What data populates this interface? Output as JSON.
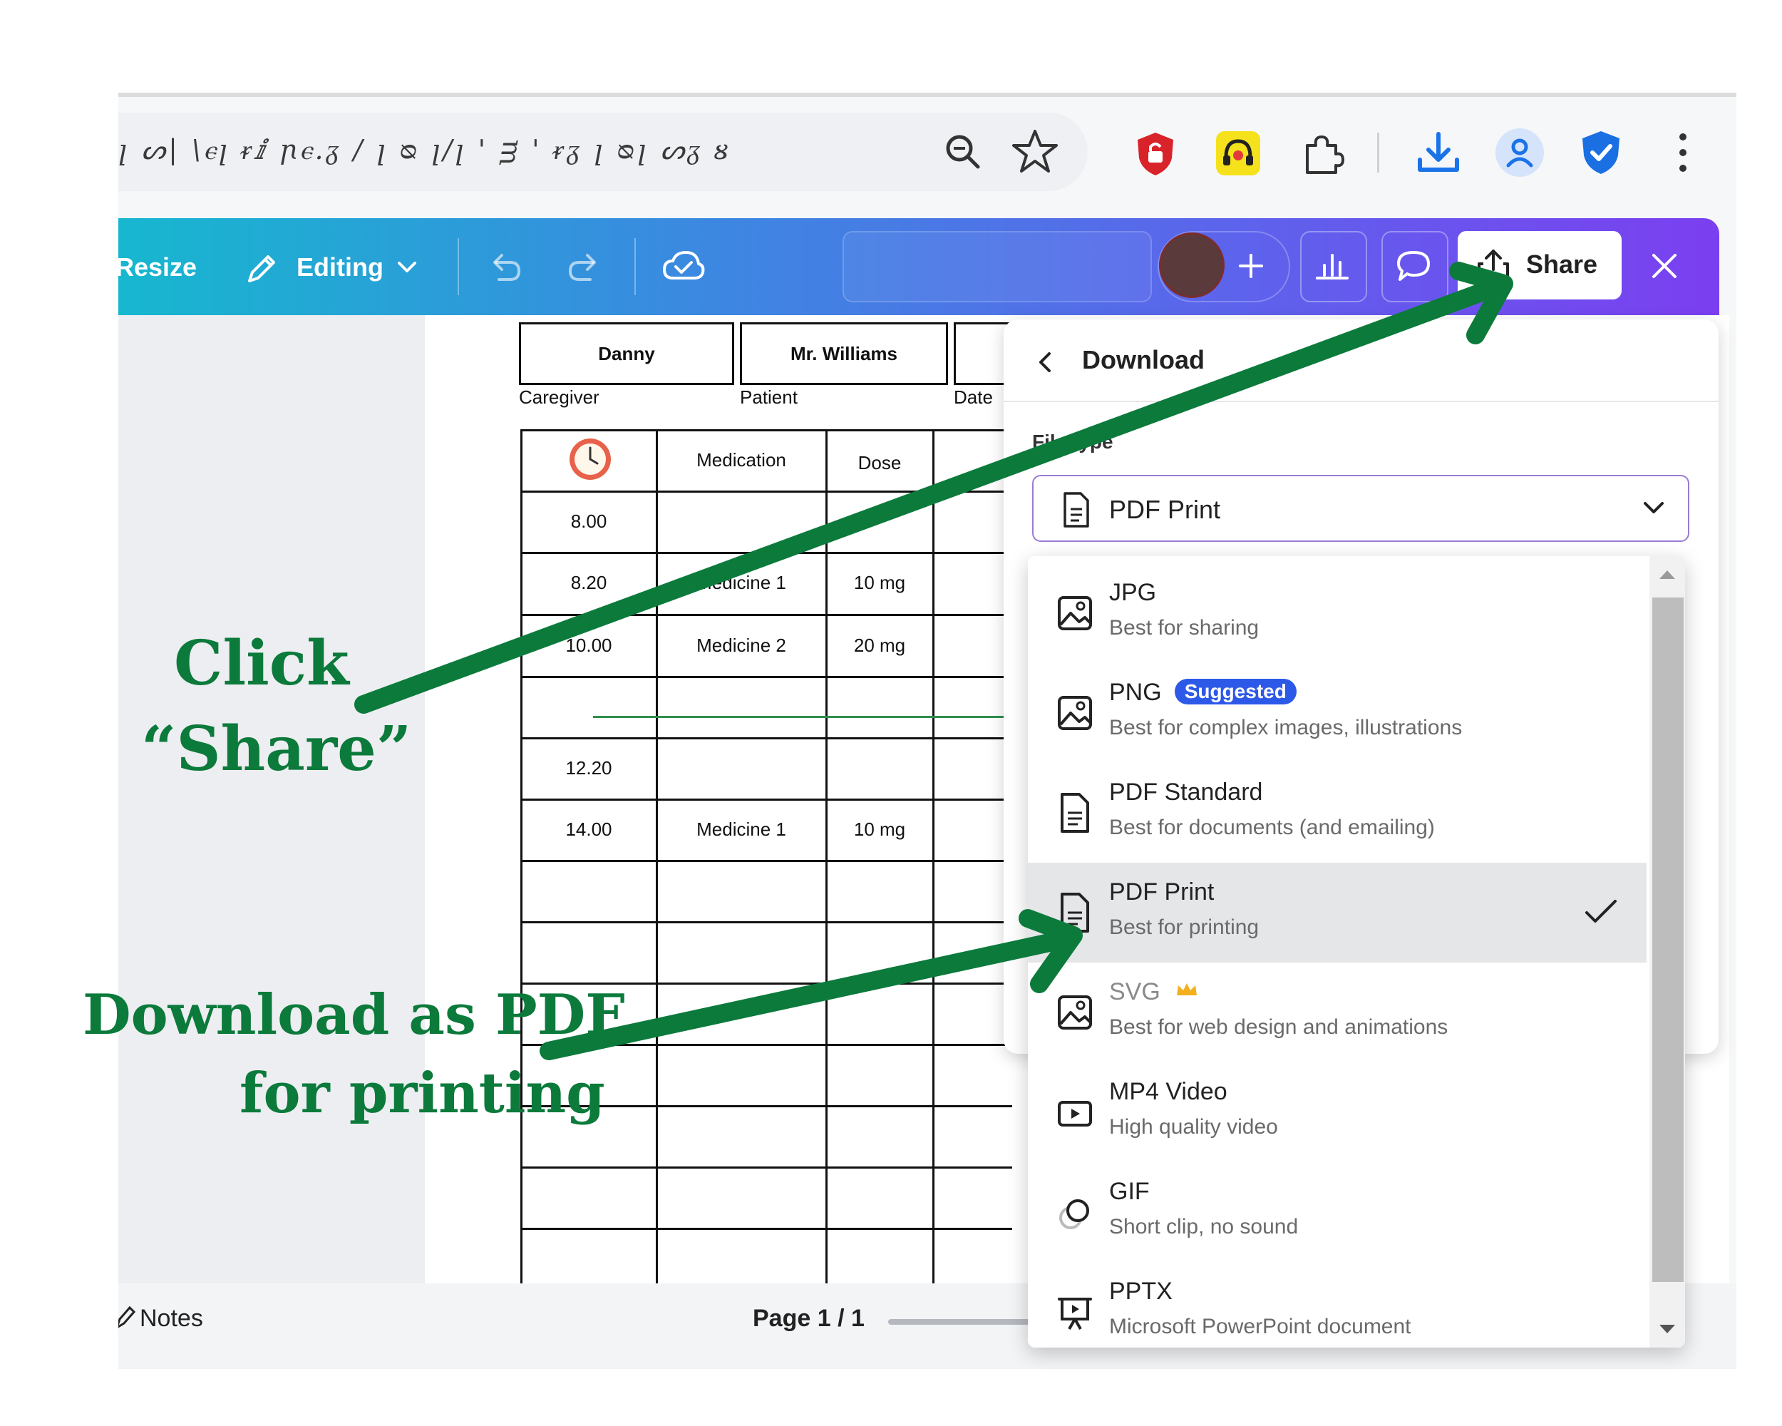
{
  "browser": {
    "address_scribble": "ꞁ ᔕ| \\ⲉꞁ ᵲⅈ ꞃⲉ.ᵹ / ꞁ ᴓ ꞁ/ꞁ ' ᴟ ' ᵲᵹ ꞁ ᴓꞁ ᔕᵹ ᴕ",
    "icons": [
      "zoom-icon",
      "bookmark-star-icon",
      "shield-extension-icon",
      "headset-extension-icon",
      "puzzle-icon",
      "download-icon",
      "profile-icon",
      "security-shield-icon",
      "more-icon"
    ]
  },
  "toolbar": {
    "resize_label": "Resize",
    "editing_label": "Editing",
    "share_label": "Share",
    "colors": {
      "accent_start": "#17b7cf",
      "accent_end": "#7b3ff0"
    }
  },
  "document": {
    "caregiver_value": "Danny",
    "caregiver_caption": "Caregiver",
    "patient_value": "Mr. Williams",
    "patient_caption": "Patient",
    "date_caption": "Date",
    "col_medication": "Medication",
    "col_dose": "Dose",
    "rows": [
      {
        "time": "8.00",
        "med": "",
        "dose": ""
      },
      {
        "time": "8.20",
        "med": "Medicine 1",
        "dose": "10 mg"
      },
      {
        "time": "10.00",
        "med": "Medicine 2",
        "dose": "20 mg"
      },
      {
        "time": "",
        "med": "",
        "dose": ""
      },
      {
        "time": "12.20",
        "med": "",
        "dose": ""
      },
      {
        "time": "14.00",
        "med": "Medicine 1",
        "dose": "10 mg"
      }
    ]
  },
  "download_panel": {
    "title": "Download",
    "file_type_label": "File type",
    "selected": "PDF Print"
  },
  "file_menu": [
    {
      "title": "JPG",
      "sub": "Best for sharing",
      "icon": "image-icon"
    },
    {
      "title": "PNG",
      "badge": "Suggested",
      "sub": "Best for complex images, illustrations",
      "icon": "image-icon"
    },
    {
      "title": "PDF Standard",
      "sub": "Best for documents (and emailing)",
      "icon": "document-icon"
    },
    {
      "title": "PDF Print",
      "sub": "Best for printing",
      "icon": "document-icon",
      "selected": true
    },
    {
      "title": "SVG",
      "sub": "Best for web design and animations",
      "icon": "image-icon",
      "premium": true
    },
    {
      "title": "MP4 Video",
      "sub": "High quality video",
      "icon": "video-icon"
    },
    {
      "title": "GIF",
      "sub": "Short clip, no sound",
      "icon": "gif-icon"
    },
    {
      "title": "PPTX",
      "sub": "Microsoft PowerPoint document",
      "icon": "presentation-icon"
    }
  ],
  "footer": {
    "notes_label": "Notes",
    "page_label": "Page 1 / 1"
  },
  "annotations": {
    "click_line1": "Click",
    "click_line2": "“Share”",
    "download_line1": "Download as PDF",
    "download_line2": "for printing",
    "color": "#0b7a3b"
  }
}
